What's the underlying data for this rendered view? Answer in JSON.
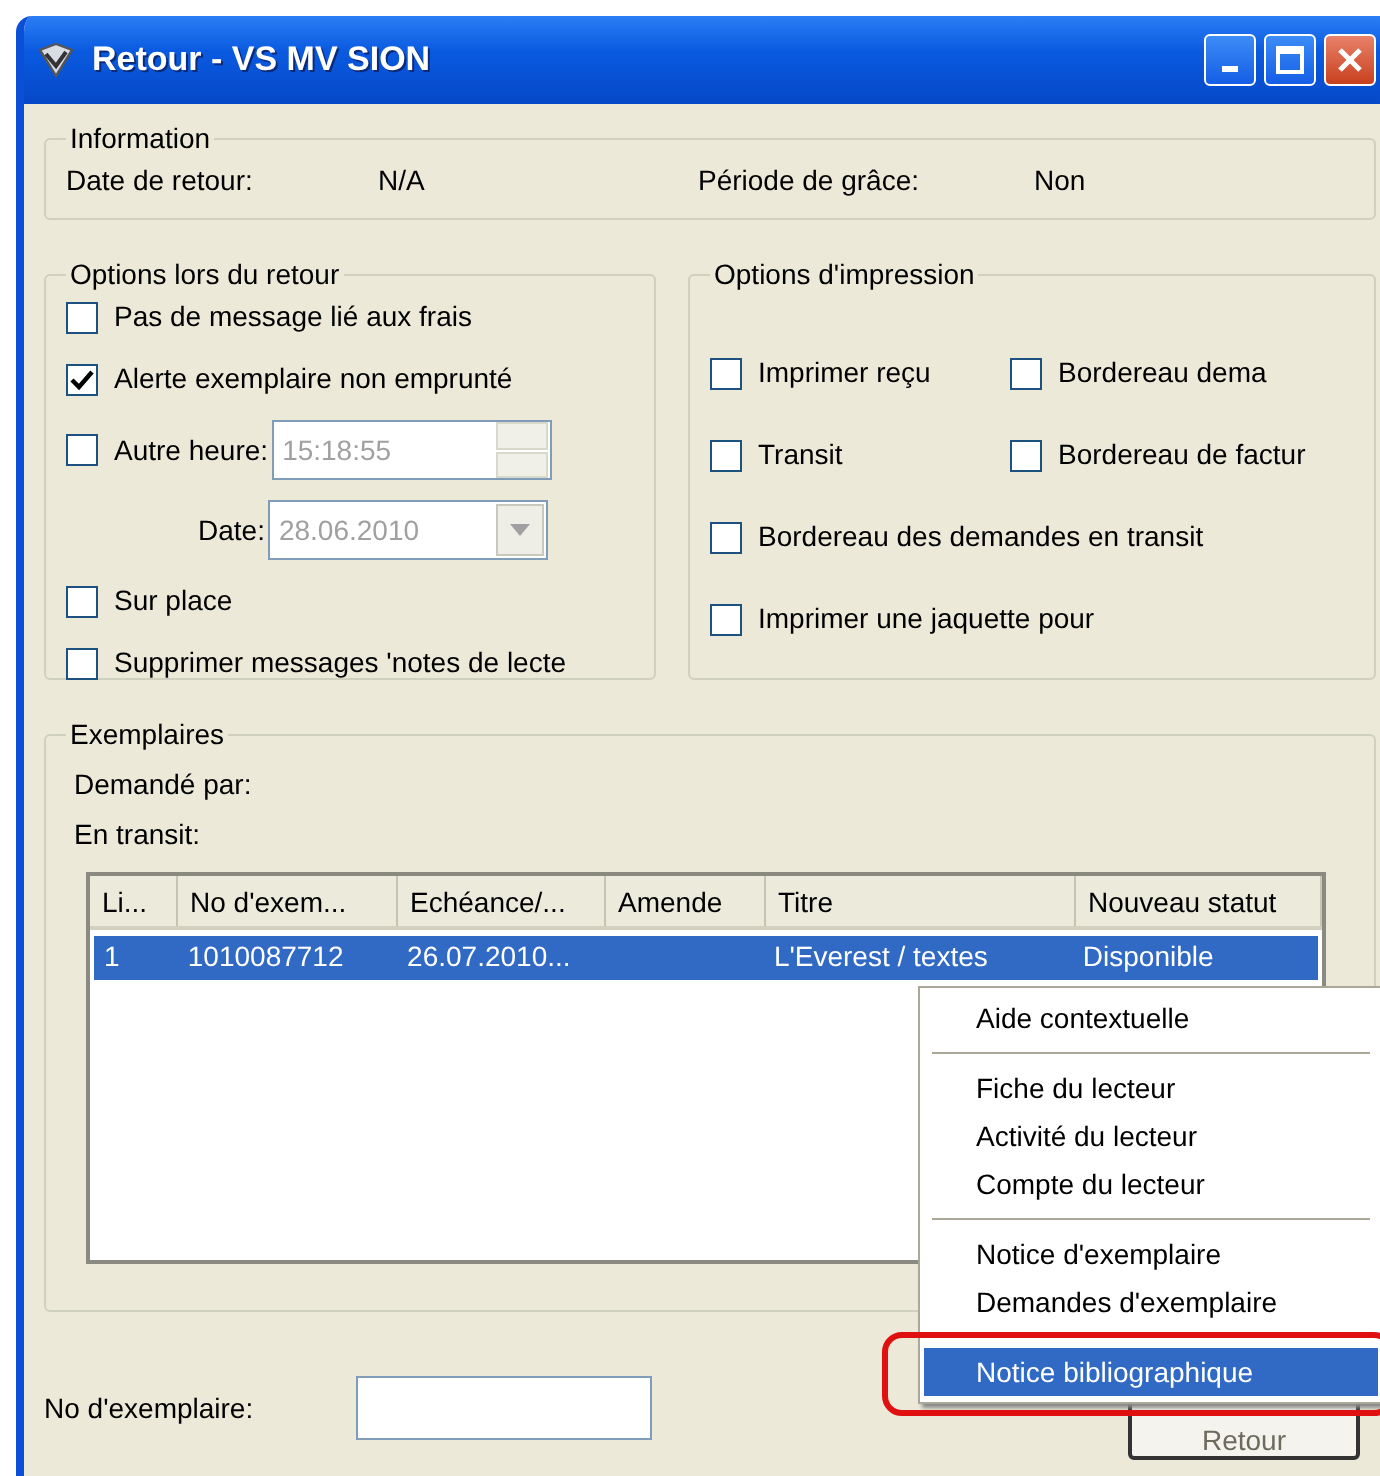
{
  "window": {
    "title": "Retour - VS MV SION"
  },
  "information": {
    "title": "Information",
    "fields": [
      {
        "label": "Date de retour:",
        "value": "N/A"
      },
      {
        "label": "Période de grâce:",
        "value": "Non"
      }
    ]
  },
  "return_options": {
    "title": "Options lors du retour",
    "items": [
      {
        "kind": "checkbox",
        "label": "Pas de message lié aux frais",
        "checked": false
      },
      {
        "kind": "checkbox",
        "label": "Alerte exemplaire non emprunté",
        "checked": true
      },
      {
        "kind": "time",
        "label": "Autre heure:",
        "checked": false,
        "value": "15:18:55",
        "disabled": true
      },
      {
        "kind": "date",
        "label": "Date:",
        "value": "28.06.2010",
        "disabled": true
      },
      {
        "kind": "checkbox",
        "label": "Sur place",
        "checked": false
      },
      {
        "kind": "checkbox",
        "label": "Supprimer messages 'notes de lecte",
        "checked": false
      }
    ]
  },
  "print_options": {
    "title": "Options d'impression",
    "items": [
      {
        "label": "Imprimer reçu",
        "checked": false
      },
      {
        "label": "Bordereau dema",
        "checked": false
      },
      {
        "label": "Transit",
        "checked": false
      },
      {
        "label": "Bordereau de factur",
        "checked": false
      },
      {
        "label": "Bordereau des demandes en transit",
        "checked": false
      },
      {
        "label": "Imprimer une jaquette pour",
        "checked": false
      }
    ]
  },
  "copies": {
    "title": "Exemplaires",
    "labels": [
      "Demandé par:",
      "En transit:"
    ],
    "table": {
      "columns": [
        "Li...",
        "No d'exem...",
        "Echéance/...",
        "Amende",
        "Titre",
        "Nouveau statut"
      ],
      "rows": [
        {
          "cells": [
            "1",
            "1010087712",
            "26.07.2010...",
            "",
            "L'Everest / textes",
            "Disponible"
          ],
          "selected": true
        }
      ]
    }
  },
  "copy_number": {
    "label": "No d'exemplaire:"
  },
  "buttons": [
    {
      "label": "Retour",
      "disabled": true
    }
  ],
  "context_menu": {
    "groups": [
      [
        {
          "label": "Aide contextuelle",
          "selected": false
        }
      ],
      [
        {
          "label": "Fiche du lecteur",
          "selected": false
        },
        {
          "label": "Activité du lecteur",
          "selected": false
        },
        {
          "label": "Compte du lecteur",
          "selected": false
        }
      ],
      [
        {
          "label": "Notice d'exemplaire",
          "selected": false
        },
        {
          "label": "Demandes d'exemplaire",
          "selected": false
        }
      ],
      [
        {
          "label": "Notice bibliographique",
          "selected": true
        }
      ]
    ]
  }
}
